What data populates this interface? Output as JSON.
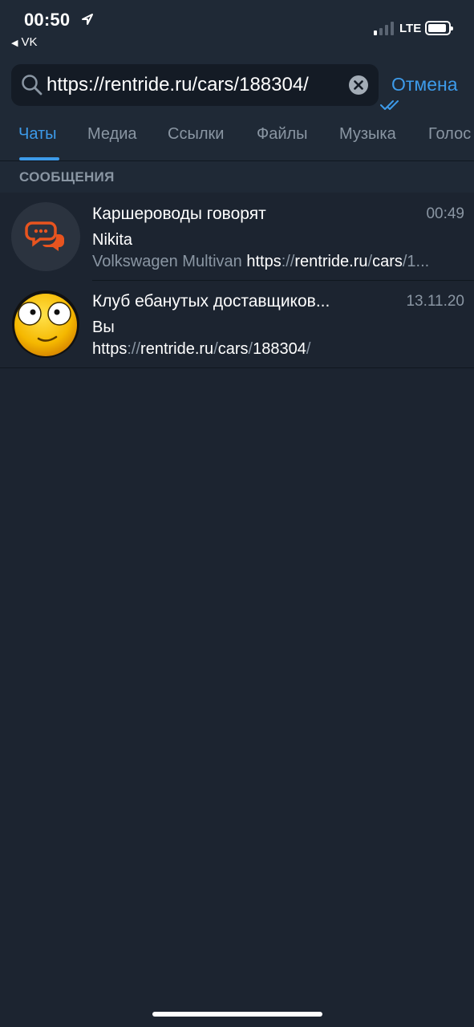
{
  "status_bar": {
    "time": "00:50",
    "back_app": "VK",
    "network": "LTE"
  },
  "search": {
    "query": "https://rentride.ru/cars/188304/",
    "cancel_label": "Отмена"
  },
  "tabs": [
    {
      "label": "Чаты",
      "active": true
    },
    {
      "label": "Медиа",
      "active": false
    },
    {
      "label": "Ссылки",
      "active": false
    },
    {
      "label": "Файлы",
      "active": false
    },
    {
      "label": "Музыка",
      "active": false
    },
    {
      "label": "Голос",
      "active": false
    }
  ],
  "section": {
    "title": "СООБЩЕНИЯ"
  },
  "chats": [
    {
      "title": "Каршероводы говорят",
      "time": "00:49",
      "sender": "Nikita",
      "preview_prefix": "Volkswagen Multivan ",
      "preview_link_a": "https",
      "preview_link_b": "://",
      "preview_link_c": "rentride.ru",
      "preview_link_d": "/",
      "preview_link_e": "cars",
      "preview_link_f": "/1..."
    },
    {
      "title": "Клуб ебанутых доставщиков...",
      "time": "13.11.20",
      "sender": "Вы",
      "preview_link_a": "https",
      "preview_link_b": "://",
      "preview_link_c": "rentride.ru",
      "preview_link_d": "/",
      "preview_link_e": "cars",
      "preview_link_f": "/",
      "preview_link_g": "188304",
      "preview_link_h": "/"
    }
  ],
  "colors": {
    "background": "#1c2430",
    "header": "#1f2936",
    "accent": "#3d9bea",
    "muted_text": "#8a96a3",
    "avatar_orange": "#e8541f"
  }
}
